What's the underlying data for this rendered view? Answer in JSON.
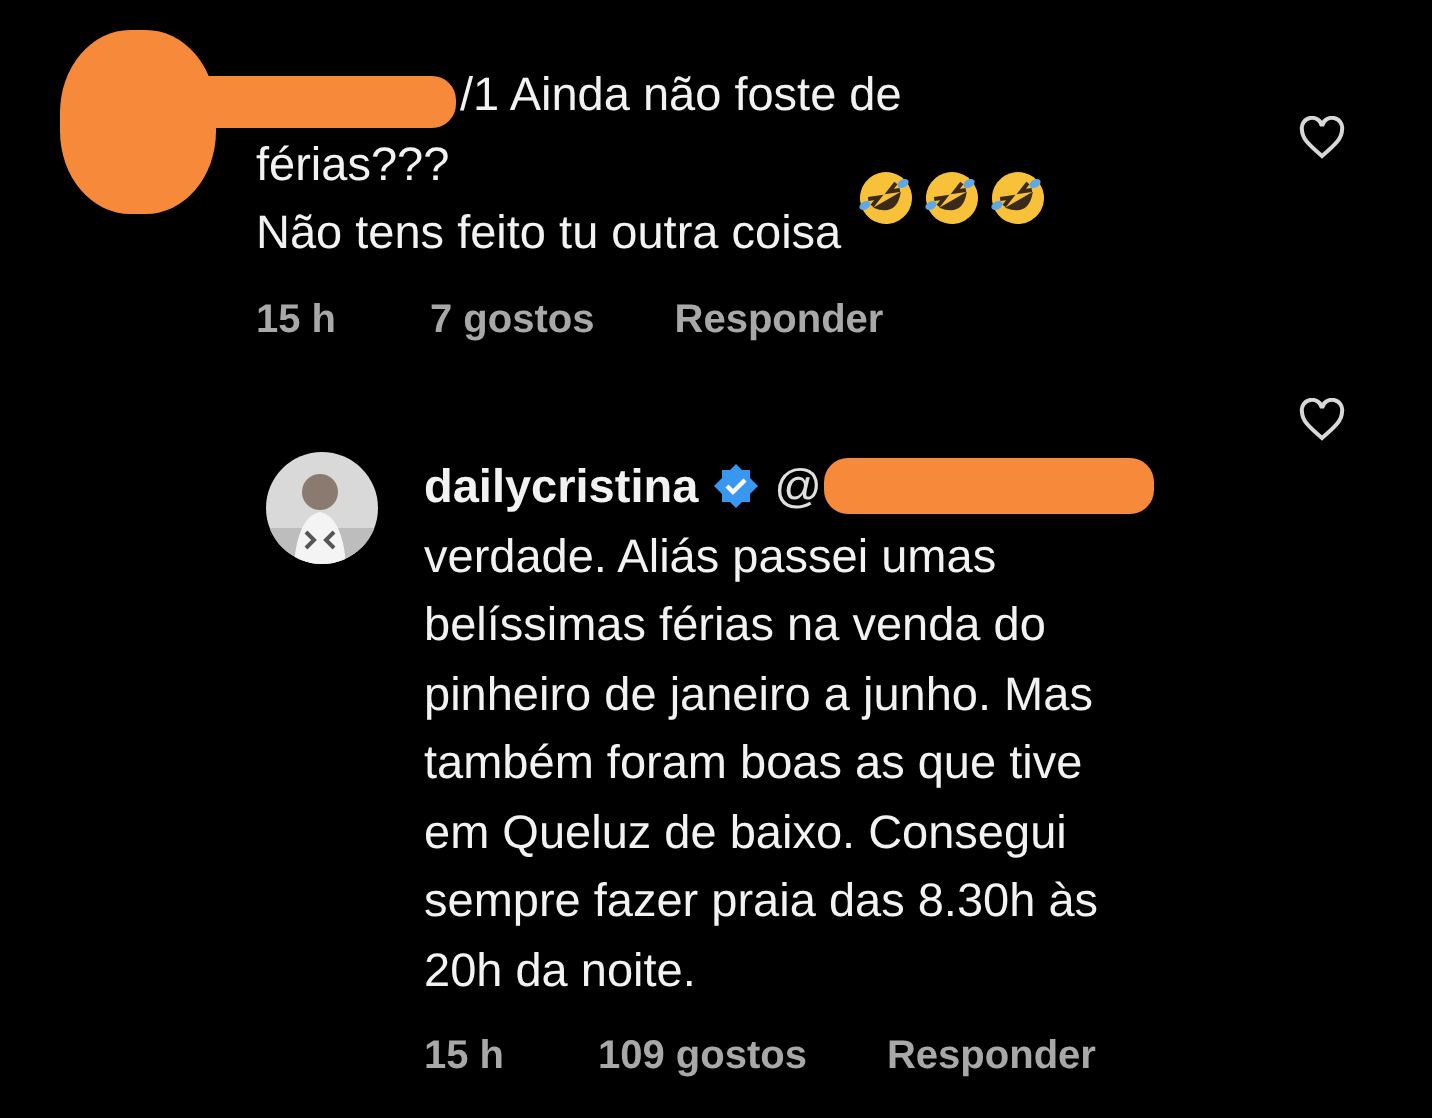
{
  "comments": [
    {
      "first_line": "/1 Ainda não foste de",
      "lines": [
        "férias???",
        "Não tens feito tu outra coisa"
      ],
      "time": "15 h",
      "likes": "7 gostos",
      "reply": "Responder",
      "liked": false
    },
    {
      "username": "dailycristina",
      "verified": true,
      "mention": "@",
      "lines": [
        "verdade. Aliás passei umas",
        "belíssimas férias na venda do",
        "pinheiro de janeiro a junho. Mas",
        "também foram boas as que tive",
        "em Queluz de baixo. Consegui",
        "sempre fazer praia das 8.30h às",
        "20h da noite."
      ],
      "time": "15 h",
      "likes": "109 gostos",
      "reply": "Responder",
      "liked": false
    }
  ]
}
